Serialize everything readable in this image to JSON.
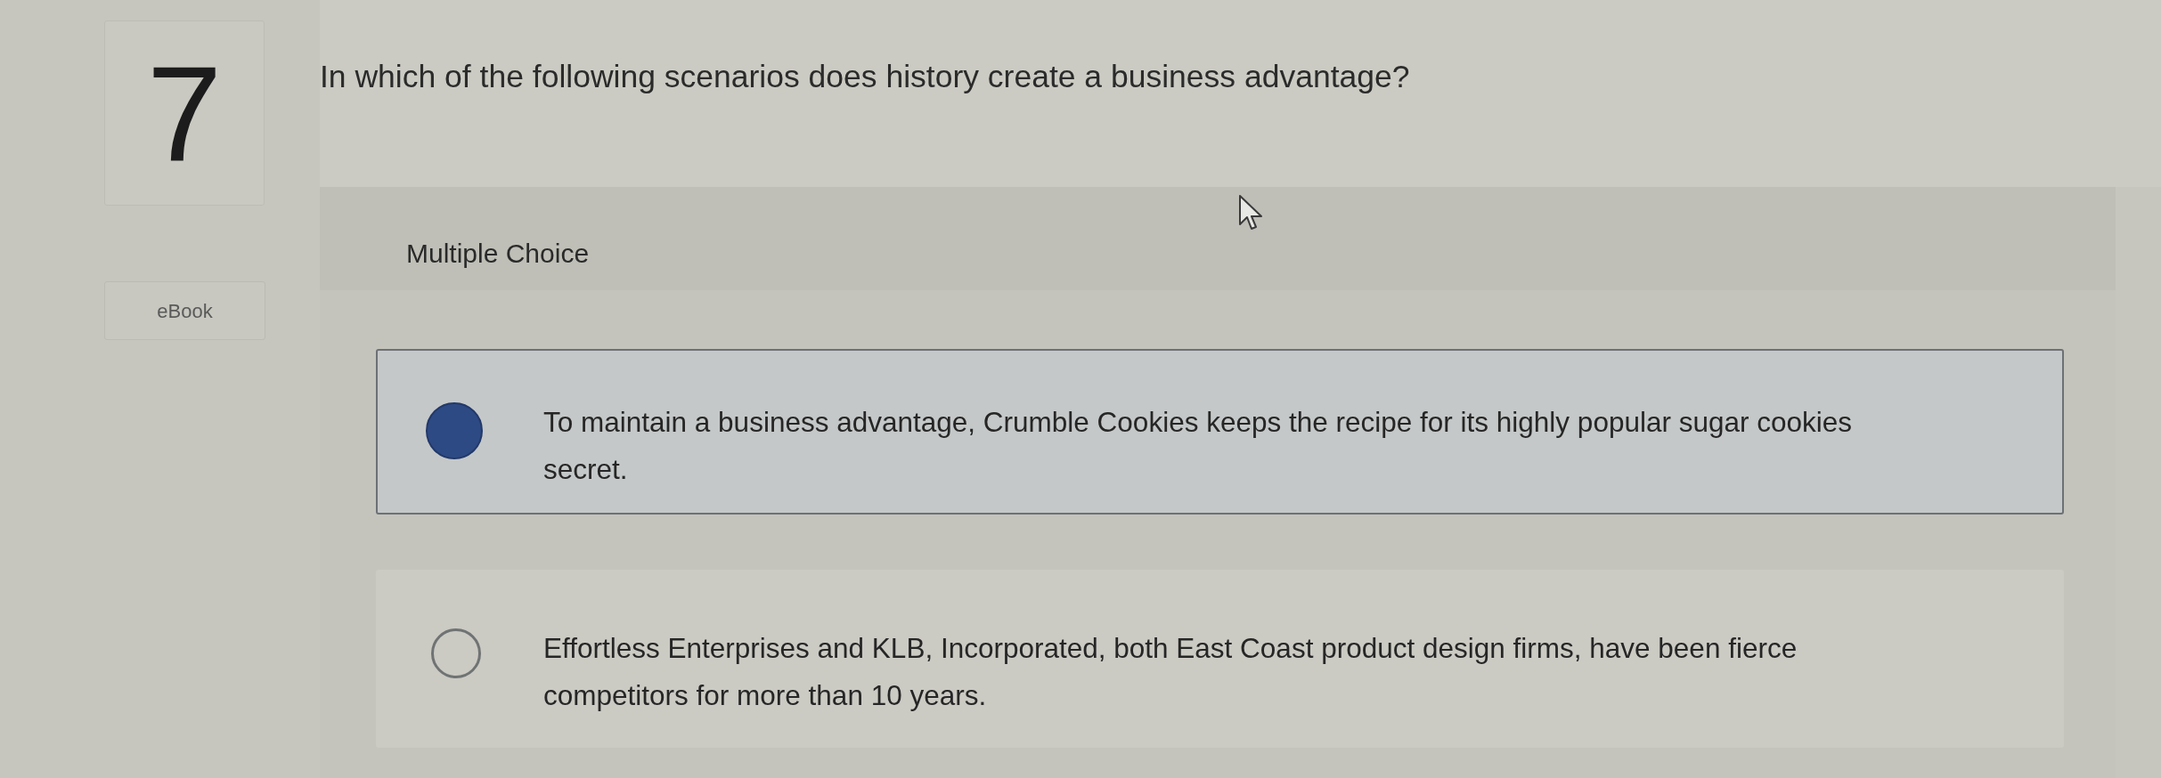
{
  "question": {
    "number": "7",
    "text": "In which of the following scenarios does history create a business advantage?",
    "ebook_button": "eBook"
  },
  "answer_panel": {
    "type_label": "Multiple Choice",
    "options": [
      {
        "text": "To maintain a business advantage, Crumble Cookies keeps the recipe for its highly popular sugar cookies secret.",
        "selected": true
      },
      {
        "text": "Effortless Enterprises and KLB, Incorporated, both East Coast product design firms, have been fierce competitors for more than 10 years.",
        "selected": false
      }
    ]
  }
}
